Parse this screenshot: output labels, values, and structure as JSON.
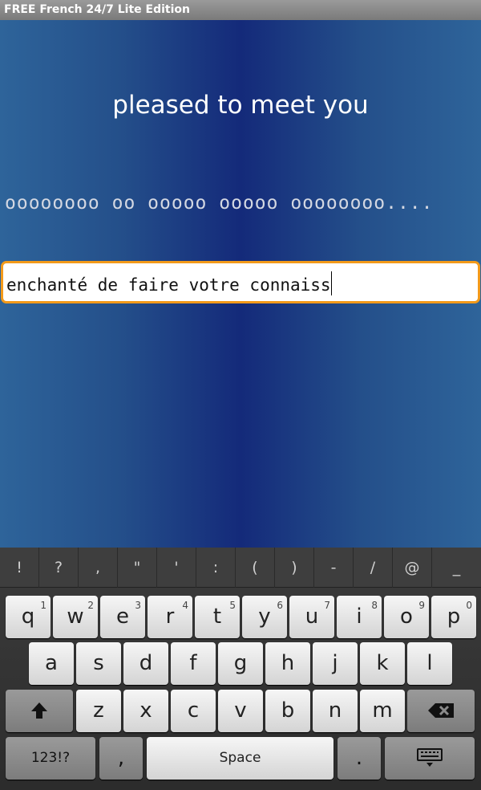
{
  "app": {
    "title": "FREE French 24/7 Lite Edition"
  },
  "lesson": {
    "english": "pleased to meet you",
    "hint": "oooooooo oo ooooo ooooo oooooooo....",
    "answer_value": "enchanté de faire votre connaiss"
  },
  "keyboard": {
    "symbols": [
      "!",
      "?",
      ",",
      "\"",
      "'",
      ":",
      "(",
      ")",
      "-",
      "/",
      "@",
      "_"
    ],
    "row1": [
      {
        "label": "q",
        "sup": "1"
      },
      {
        "label": "w",
        "sup": "2"
      },
      {
        "label": "e",
        "sup": "3"
      },
      {
        "label": "r",
        "sup": "4"
      },
      {
        "label": "t",
        "sup": "5"
      },
      {
        "label": "y",
        "sup": "6"
      },
      {
        "label": "u",
        "sup": "7"
      },
      {
        "label": "i",
        "sup": "8"
      },
      {
        "label": "o",
        "sup": "9"
      },
      {
        "label": "p",
        "sup": "0"
      }
    ],
    "row2": [
      "a",
      "s",
      "d",
      "f",
      "g",
      "h",
      "j",
      "k",
      "l"
    ],
    "row3": [
      "z",
      "x",
      "c",
      "v",
      "b",
      "n",
      "m"
    ],
    "mode_label": "123!?",
    "comma_label": ",",
    "space_label": "Space",
    "period_label": ".",
    "shift_icon": "up-arrow-icon",
    "backspace_icon": "backspace-icon",
    "hide_keyboard_icon": "keyboard-icon"
  }
}
